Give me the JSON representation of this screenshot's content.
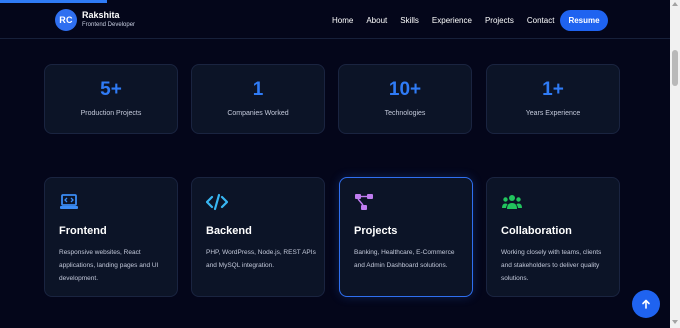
{
  "scroll_progress": 0.16,
  "brand": {
    "initials": "RC",
    "name": "Rakshita",
    "role": "Frontend Developer"
  },
  "nav": {
    "links": [
      "Home",
      "About",
      "Skills",
      "Experience",
      "Projects",
      "Contact"
    ],
    "resume_label": "Resume"
  },
  "stats": [
    {
      "value": "5+",
      "label": "Production Projects"
    },
    {
      "value": "1",
      "label": "Companies Worked"
    },
    {
      "value": "10+",
      "label": "Technologies"
    },
    {
      "value": "1+",
      "label": "Years Experience"
    }
  ],
  "features": [
    {
      "icon": "laptop-code-icon",
      "title": "Frontend",
      "desc": "Responsive websites, React applications, landing pages and UI development."
    },
    {
      "icon": "code-icon",
      "title": "Backend",
      "desc": "PHP, WordPress, Node.js, REST APIs and MySQL integration."
    },
    {
      "icon": "project-diagram-icon",
      "title": "Projects",
      "desc": "Banking, Healthcare, E-Commerce and Admin Dashboard solutions."
    },
    {
      "icon": "users-icon",
      "title": "Collaboration",
      "desc": "Working closely with teams, clients and stakeholders to deliver quality solutions."
    }
  ],
  "colors": {
    "background": "#04061a",
    "card": "#0c1427",
    "accent": "#2f7bf6",
    "icon_frontend": "#3b8cf5",
    "icon_backend": "#38b6f2",
    "icon_projects": "#c07cf0",
    "icon_collaboration": "#22c55e"
  },
  "back_to_top_icon": "arrow-up-icon"
}
